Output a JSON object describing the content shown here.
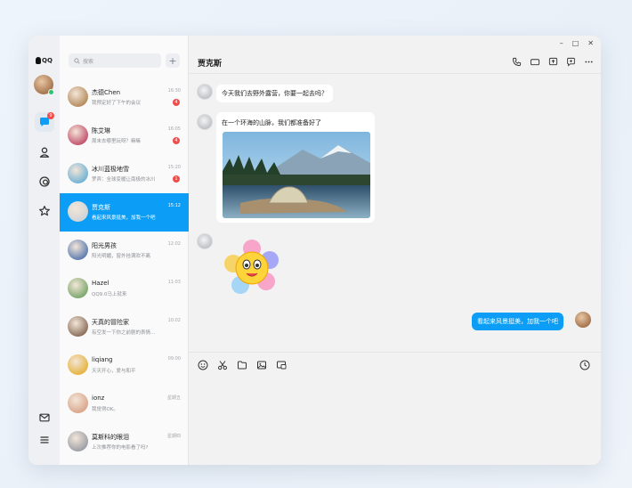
{
  "app": {
    "logo_text": "QQ"
  },
  "window_controls": {
    "minimize": "–",
    "maximize": "□",
    "close": "✕"
  },
  "rail": {
    "chat_badge": "9"
  },
  "search": {
    "placeholder": "搜索",
    "add_label": "+"
  },
  "chats": [
    {
      "name": "杰德Chen",
      "preview": "我预定好了下午的会议",
      "time": "16:30",
      "badge": "4",
      "avatar_color": "#b48a5c"
    },
    {
      "name": "陈艾琳",
      "preview": "周末去哪里玩呀？嘛嘛",
      "time": "16:05",
      "badge": "4",
      "avatar_color": "#c24f6c"
    },
    {
      "name": "冰川蓝极地雪",
      "preview": "罗宾：全球变暖让南极的冰川",
      "time": "15:20",
      "badge": "1",
      "avatar_color": "#6fb2d6"
    },
    {
      "name": "贾克斯",
      "preview": "看起来风景挺美，加我一个吧",
      "time": "15:12",
      "badge": "",
      "avatar_color": "#cfd3d8",
      "active": true
    },
    {
      "name": "阳光男孩",
      "preview": "阳光明媚，窗外挂满欢不离",
      "time": "12:02",
      "badge": "",
      "avatar_color": "#5a7ab0"
    },
    {
      "name": "Hazel",
      "preview": "QQ9.0马上就来",
      "time": "11:03",
      "badge": "",
      "avatar_color": "#7aa66a"
    },
    {
      "name": "天真的冒险家",
      "preview": "有空发一下你之前剧的表情...",
      "time": "10:02",
      "badge": "",
      "avatar_color": "#8a6d5a"
    },
    {
      "name": "liqiang",
      "preview": "天天开心，爱与和平",
      "time": "09:00",
      "badge": "",
      "avatar_color": "#e6b23c"
    },
    {
      "name": "ionz",
      "preview": "我觉得OK。",
      "time": "星期五",
      "badge": "",
      "avatar_color": "#d9a48a"
    },
    {
      "name": "莫斯科的眼泪",
      "preview": "上次推荐你的电影看了吗?",
      "time": "星期四",
      "badge": "",
      "avatar_color": "#9a9ea6"
    }
  ],
  "conversation": {
    "title": "贾克斯",
    "messages": [
      {
        "text": "今天我们去野外露营，你要一起去吗？"
      },
      {
        "text": "在一个环海的山脉，我们都准备好了"
      },
      {
        "text": "看起来风景挺美，加我一个吧"
      }
    ]
  },
  "colors": {
    "accent": "#0c9ef7",
    "badge": "#f14c4c",
    "online": "#2ec26a"
  }
}
